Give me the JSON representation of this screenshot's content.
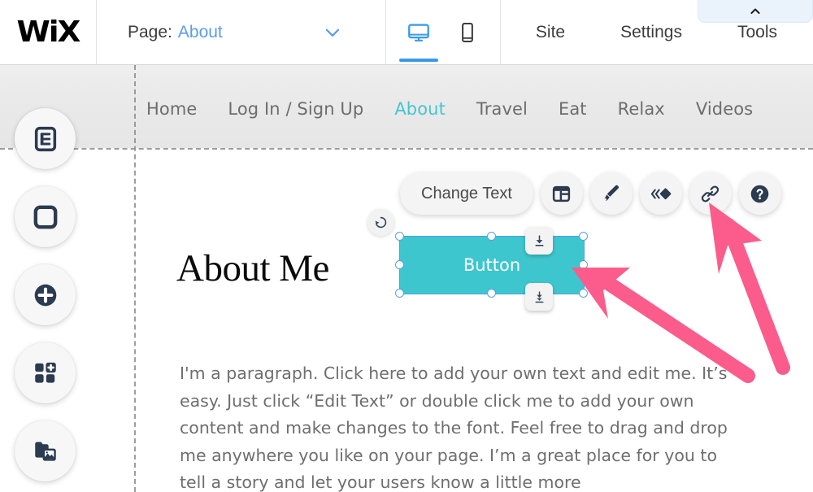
{
  "editor": {
    "brand": "WiX",
    "page_bar": {
      "label": "Page:",
      "value": "About",
      "chevron_icon": "chevron-down-icon"
    },
    "viewport_toggle": {
      "desktop_icon": "desktop-icon",
      "mobile_icon": "mobile-icon",
      "active": "desktop"
    },
    "menu": [
      {
        "label": "Site"
      },
      {
        "label": "Settings"
      },
      {
        "label": "Tools"
      }
    ],
    "tools_tab": {
      "chevron_icon": "chevron-up-icon"
    }
  },
  "sidebar": {
    "items": [
      {
        "name": "menus-and-pages",
        "icon": "pages-document-icon"
      },
      {
        "name": "background",
        "icon": "background-square-icon"
      },
      {
        "name": "add",
        "icon": "plus-circle-icon"
      },
      {
        "name": "add-apps",
        "icon": "apps-grid-plus-icon"
      },
      {
        "name": "my-uploads",
        "icon": "media-images-icon"
      }
    ]
  },
  "site_nav": {
    "items": [
      {
        "label": "Home",
        "active": false
      },
      {
        "label": "Log In / Sign Up",
        "active": false
      },
      {
        "label": "About",
        "active": true
      },
      {
        "label": "Travel",
        "active": false
      },
      {
        "label": "Eat",
        "active": false
      },
      {
        "label": "Relax",
        "active": false
      },
      {
        "label": "Videos",
        "active": false
      }
    ]
  },
  "canvas": {
    "heading": "About Me",
    "paragraph": "I'm a paragraph. Click here to add your own text and edit me. It’s easy. Just click “Edit Text” or double click me to add your own content and make changes to the font. Feel free to drag and drop me anywhere you like on your page. I’m a great place for you to tell a story and let your users know a little more",
    "selected_element": {
      "type": "button",
      "label": "Button",
      "fill_color": "#3EC6CE",
      "selection_color": "#4A9FE8",
      "rotate_icon": "rotate-counterclockwise-icon",
      "dock_top_icon": "dock-to-top-icon",
      "dock_bottom_icon": "dock-to-bottom-icon"
    }
  },
  "element_toolbar": {
    "change_text_label": "Change Text",
    "buttons": [
      {
        "name": "layouts",
        "icon": "layout-panel-icon"
      },
      {
        "name": "design",
        "icon": "paint-brush-icon"
      },
      {
        "name": "animation",
        "icon": "animation-icon"
      },
      {
        "name": "link",
        "icon": "link-chain-icon"
      },
      {
        "name": "help",
        "icon": "help-question-icon"
      }
    ]
  },
  "annotations": {
    "arrow_color": "#FB5C8C",
    "arrows": [
      {
        "name": "arrow-to-link-button",
        "points_to": "link"
      },
      {
        "name": "arrow-to-selected-button",
        "points_to": "button"
      }
    ]
  },
  "colors": {
    "teal": "#3EC6CE",
    "blue": "#3899EC",
    "pink": "#FB5C8C",
    "dark_navy": "#2B3B50"
  }
}
